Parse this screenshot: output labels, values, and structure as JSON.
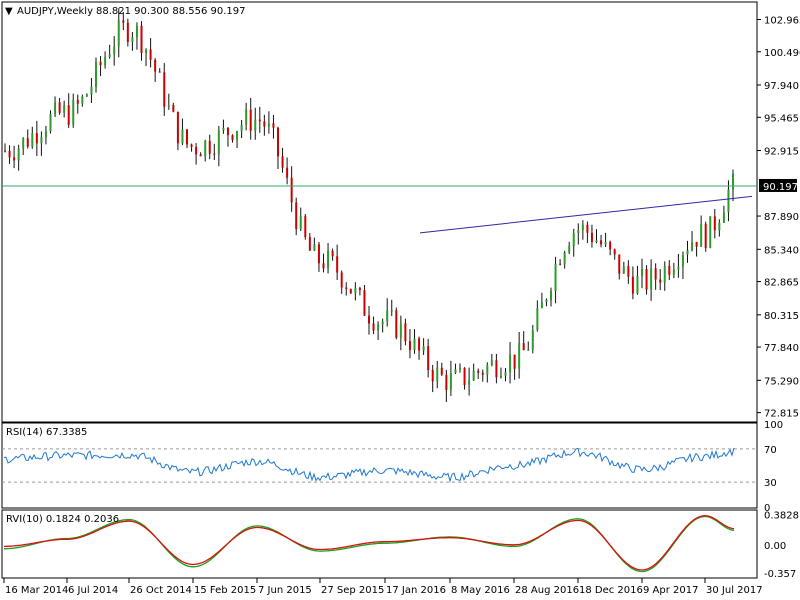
{
  "header": {
    "symbol_timeframe": "AUDJPY,Weekly",
    "ohlc": "88.821 90.300 88.556 90.197",
    "collapse_marker": "▼"
  },
  "colors": {
    "bull": "#2e9a2e",
    "bear": "#cc0000",
    "wick": "#111111",
    "hline": "#3aa86a",
    "trendline": "#2a2aa8",
    "rsi": "#1e78d0",
    "rvi_main": "#1aa01a",
    "rvi_signal": "#dd1111",
    "price_tag_bg": "#000000",
    "frame": "#000000"
  },
  "chart_data": [
    {
      "type": "candlestick",
      "panel": "price",
      "title": "AUDJPY,Weekly",
      "ylim": [
        72.4,
        104.0
      ],
      "y_ticks": [
        "102.965",
        "100.490",
        "97.940",
        "95.465",
        "92.915",
        "90.197",
        "87.890",
        "85.340",
        "82.865",
        "80.315",
        "77.840",
        "75.290",
        "72.815"
      ],
      "x_ticks": [
        "16 Mar 2014",
        "6 Jul 2014",
        "26 Oct 2014",
        "15 Feb 2015",
        "7 Jun 2015",
        "27 Sep 2015",
        "17 Jan 2016",
        "8 May 2016",
        "28 Aug 2016",
        "18 Dec 2016",
        "9 Apr 2017",
        "30 Jul 2017"
      ],
      "last_price": "90.197",
      "close_anchors": [
        [
          "16 Mar 2014",
          92.9
        ],
        [
          "6 Jul 2014",
          95.8
        ],
        [
          "26 Oct 2014",
          102.3
        ],
        [
          "15 Feb 2015",
          93.2
        ],
        [
          "7 Jun 2015",
          95.3
        ],
        [
          "27 Sep 2015",
          84.5
        ],
        [
          "17 Jan 2016",
          79.8
        ],
        [
          "8 May 2016",
          75.3
        ],
        [
          "28 Aug 2016",
          76.9
        ],
        [
          "18 Dec 2016",
          86.9
        ],
        [
          "9 Apr 2017",
          82.8
        ],
        [
          "30 Jul 2017",
          86.5
        ],
        [
          "latest",
          90.197
        ]
      ],
      "horizontal_line": 90.197,
      "trendline": {
        "from": [
          "17 Jan 2016",
          86.6
        ],
        "to": [
          "latest",
          89.4
        ]
      }
    },
    {
      "type": "line",
      "panel": "indicator",
      "title": "RSI(14) 67.3385",
      "ylim": [
        0,
        100
      ],
      "y_ticks": [
        "100",
        "70",
        "30",
        "0"
      ],
      "levels": [
        70,
        30
      ],
      "series": [
        {
          "name": "RSI(14)",
          "anchors": [
            [
              "16 Mar 2014",
              58
            ],
            [
              "6 Jul 2014",
              62
            ],
            [
              "26 Oct 2014",
              63
            ],
            [
              "15 Feb 2015",
              42
            ],
            [
              "7 Jun 2015",
              55
            ],
            [
              "27 Sep 2015",
              36
            ],
            [
              "17 Jan 2016",
              44
            ],
            [
              "8 May 2016",
              36
            ],
            [
              "28 Aug 2016",
              50
            ],
            [
              "18 Dec 2016",
              66
            ],
            [
              "9 Apr 2017",
              45
            ],
            [
              "30 Jul 2017",
              61
            ],
            [
              "latest",
              67.3385
            ]
          ]
        }
      ]
    },
    {
      "type": "line",
      "panel": "indicator",
      "title": "RVI(10) 0.1824 0.2036",
      "ylim": [
        -0.41,
        0.43
      ],
      "y_ticks": [
        "0.3828",
        "0.00",
        "-0.357"
      ],
      "series": [
        {
          "name": "RVI main",
          "last": 0.1824,
          "anchors": [
            [
              "16 Mar 2014",
              -0.05
            ],
            [
              "6 Jul 2014",
              0.08
            ],
            [
              "26 Oct 2014",
              0.32
            ],
            [
              "15 Feb 2015",
              -0.28
            ],
            [
              "7 Jun 2015",
              0.24
            ],
            [
              "27 Sep 2015",
              -0.08
            ],
            [
              "17 Jan 2016",
              0.02
            ],
            [
              "8 May 2016",
              0.1
            ],
            [
              "28 Aug 2016",
              -0.02
            ],
            [
              "18 Dec 2016",
              0.33
            ],
            [
              "9 Apr 2017",
              -0.34
            ],
            [
              "30 Jul 2017",
              0.36
            ],
            [
              "latest",
              0.1824
            ]
          ]
        },
        {
          "name": "RVI signal",
          "last": 0.2036,
          "anchors": [
            [
              "16 Mar 2014",
              -0.02
            ],
            [
              "6 Jul 2014",
              0.07
            ],
            [
              "26 Oct 2014",
              0.3
            ],
            [
              "15 Feb 2015",
              -0.25
            ],
            [
              "7 Jun 2015",
              0.22
            ],
            [
              "27 Sep 2015",
              -0.06
            ],
            [
              "17 Jan 2016",
              0.04
            ],
            [
              "8 May 2016",
              0.09
            ],
            [
              "28 Aug 2016",
              0.0
            ],
            [
              "18 Dec 2016",
              0.31
            ],
            [
              "9 Apr 2017",
              -0.32
            ],
            [
              "30 Jul 2017",
              0.37
            ],
            [
              "latest",
              0.2036
            ]
          ]
        }
      ]
    }
  ]
}
